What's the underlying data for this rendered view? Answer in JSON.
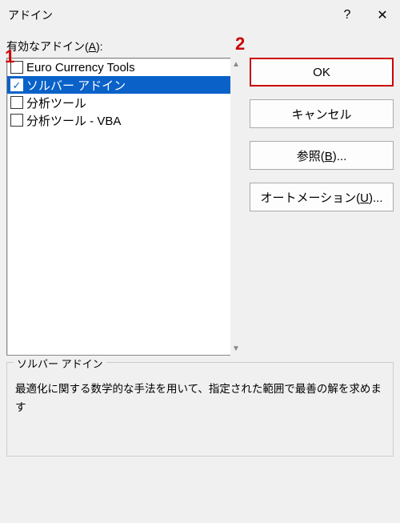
{
  "title": "アドイン",
  "help_symbol": "?",
  "close_symbol": "✕",
  "list_label_pre": "有効なアドイン(",
  "list_label_key": "A",
  "list_label_post": "):",
  "items": [
    {
      "label": "Euro Currency Tools",
      "checked": false,
      "selected": false
    },
    {
      "label": "ソルバー アドイン",
      "checked": true,
      "selected": true
    },
    {
      "label": "分析ツール",
      "checked": false,
      "selected": false
    },
    {
      "label": "分析ツール - VBA",
      "checked": false,
      "selected": false
    }
  ],
  "buttons": {
    "ok": "OK",
    "cancel": "キャンセル",
    "browse": "参照(B)...",
    "automation": "オートメーション(U)..."
  },
  "group": {
    "legend": "ソルバー アドイン",
    "description": "最適化に関する数学的な手法を用いて、指定された範囲で最善の解を求めます"
  },
  "annotations": {
    "a1": "1",
    "a2": "2"
  },
  "scroll": {
    "up": "▲",
    "down": "▼"
  }
}
